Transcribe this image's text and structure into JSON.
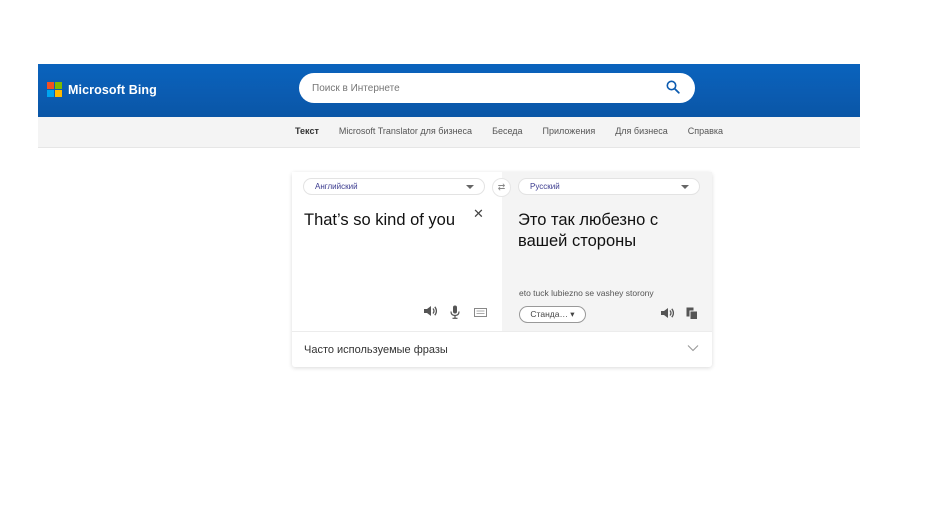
{
  "header": {
    "brand": "Microsoft Bing",
    "search_placeholder": "Поиск в Интернете",
    "search_value": ""
  },
  "nav": {
    "items": [
      {
        "label": "Текст",
        "active": true
      },
      {
        "label": "Microsoft Translator для бизнеса",
        "active": false
      },
      {
        "label": "Беседа",
        "active": false
      },
      {
        "label": "Приложения",
        "active": false
      },
      {
        "label": "Для бизнеса",
        "active": false
      },
      {
        "label": "Справка",
        "active": false
      }
    ]
  },
  "translator": {
    "source_language": "Английский",
    "target_language": "Русский",
    "source_text": "That’s so kind of you",
    "translated_text": "Это так любезно с вашей стороны",
    "transliteration": "eto tuck lubiezno se vashey storony",
    "style_select": "Станда… ▾",
    "swap_icon": "⇄",
    "clear_icon": "✕",
    "phrases_label": "Часто используемые фразы"
  },
  "colors": {
    "header_blue": "#0b5bb0",
    "nav_bg": "#f4f4f4",
    "target_pane_bg": "#f4f4f4",
    "lang_text": "#3b3b8f"
  }
}
